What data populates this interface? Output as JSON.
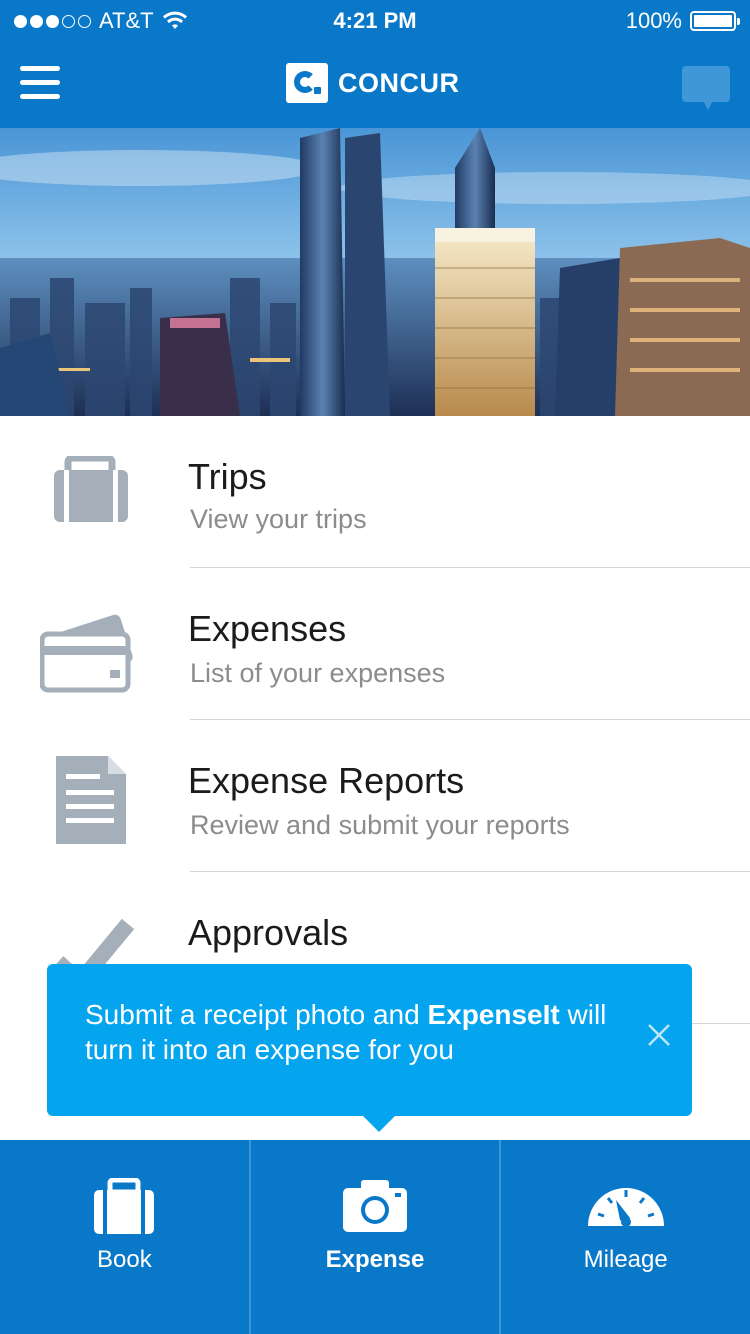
{
  "status_bar": {
    "carrier": "AT&T",
    "time": "4:21 PM",
    "battery": "100%"
  },
  "header": {
    "logo_text": "CONCUR",
    "menu_icon": "hamburger-icon",
    "chat_icon": "chat-bubble-icon"
  },
  "menu": [
    {
      "title": "Trips",
      "subtitle": "View your trips",
      "icon": "briefcase-icon"
    },
    {
      "title": "Expenses",
      "subtitle": "List of your expenses",
      "icon": "credit-card-icon"
    },
    {
      "title": "Expense Reports",
      "subtitle": "Review and submit your reports",
      "icon": "document-icon"
    },
    {
      "title": "Approvals",
      "subtitle": "",
      "icon": "checkmark-icon"
    }
  ],
  "tooltip": {
    "text_before": "Submit a receipt photo and ",
    "text_bold": "ExpenseIt",
    "text_after": " will turn it into an expense for you"
  },
  "tabs": [
    {
      "label": "Book",
      "icon": "briefcase-icon",
      "active": false
    },
    {
      "label": "Expense",
      "icon": "camera-icon",
      "active": true
    },
    {
      "label": "Mileage",
      "icon": "speedometer-icon",
      "active": false
    }
  ],
  "colors": {
    "brand_blue": "#0a78c8",
    "tooltip_blue": "#04a5ee",
    "icon_gray": "#a4afb9"
  }
}
